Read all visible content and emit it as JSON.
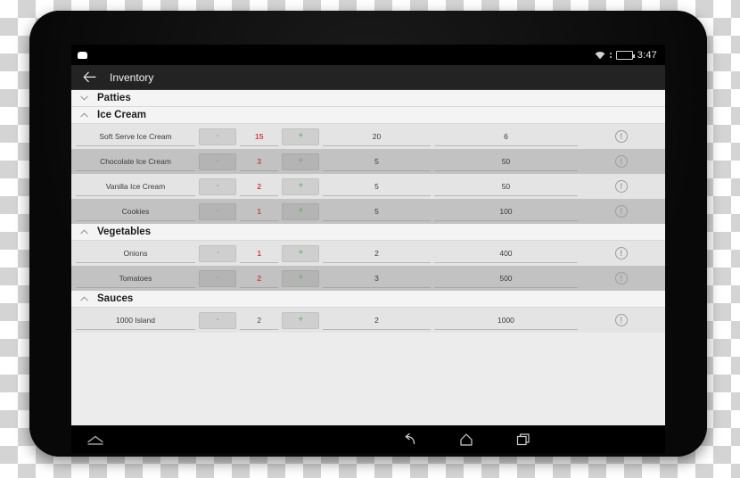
{
  "statusbar": {
    "notification_icon": "notification-icon",
    "wifi_icon": "wifi-icon",
    "battery_icon": "battery-icon",
    "time": "3:47"
  },
  "appbar": {
    "back_icon": "back-arrow-icon",
    "title": "Inventory"
  },
  "colors": {
    "appbar_bg": "#232323",
    "quantity_red": "#cf4646",
    "minus_red": "#c77a7a",
    "plus_green": "#6aa86a",
    "battery_green": "#6fbf2f",
    "row_odd": "#e4e4e4",
    "row_even": "#c2c2c2"
  },
  "controls": {
    "minus_label": "-",
    "plus_label": "+",
    "info_label": "!"
  },
  "sections": [
    {
      "title": "Patties",
      "expanded": false,
      "chevron": "chevron-down-icon",
      "items": []
    },
    {
      "title": "Ice Cream",
      "expanded": true,
      "chevron": "chevron-up-icon",
      "items": [
        {
          "name": "Soft Serve Ice Cream",
          "quantity": "15",
          "quantity_style": "red",
          "col3": "20",
          "col4": "6"
        },
        {
          "name": "Chocolate Ice Cream",
          "quantity": "3",
          "quantity_style": "red",
          "col3": "5",
          "col4": "50"
        },
        {
          "name": "Vanilla Ice Cream",
          "quantity": "2",
          "quantity_style": "red",
          "col3": "5",
          "col4": "50"
        },
        {
          "name": "Cookies",
          "quantity": "1",
          "quantity_style": "red",
          "col3": "5",
          "col4": "100"
        }
      ]
    },
    {
      "title": "Vegetables",
      "expanded": true,
      "chevron": "chevron-up-icon",
      "items": [
        {
          "name": "Onions",
          "quantity": "1",
          "quantity_style": "red",
          "col3": "2",
          "col4": "400"
        },
        {
          "name": "Tomatoes",
          "quantity": "2",
          "quantity_style": "red",
          "col3": "3",
          "col4": "500"
        }
      ]
    },
    {
      "title": "Sauces",
      "expanded": true,
      "chevron": "chevron-up-icon",
      "items": [
        {
          "name": "1000 Island",
          "quantity": "2",
          "quantity_style": "gray",
          "col3": "2",
          "col4": "1000"
        }
      ]
    }
  ],
  "navbar": {
    "expand_icon": "expand-caret-icon",
    "back_icon": "back-icon",
    "home_icon": "home-icon",
    "recents_icon": "recents-icon"
  }
}
